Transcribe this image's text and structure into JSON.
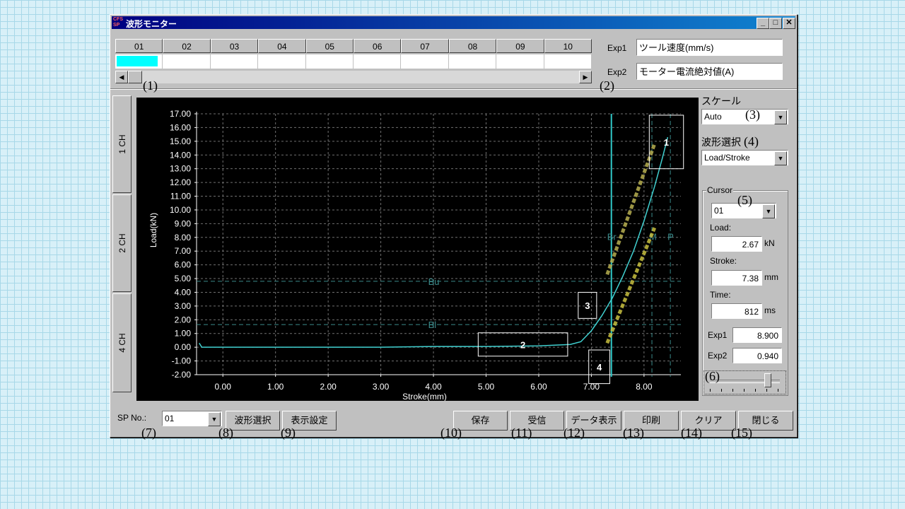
{
  "window": {
    "title": "波形モニター",
    "app_icon_text": "CFS SP"
  },
  "channels": [
    "01",
    "02",
    "03",
    "04",
    "05",
    "06",
    "07",
    "08",
    "09",
    "10"
  ],
  "channel_colors": [
    "#00ffff",
    "#ffffff",
    "#ffffff",
    "#ffffff",
    "#ffffff",
    "#ffffff",
    "#ffffff",
    "#ffffff",
    "#ffffff",
    "#ffffff"
  ],
  "exp": {
    "exp1_label": "Exp1",
    "exp1_value": "ツール速度(mm/s)",
    "exp2_label": "Exp2",
    "exp2_value": "モーター電流絶対値(A)"
  },
  "side_tabs": [
    "1 CH",
    "2 CH",
    "4 CH"
  ],
  "scale": {
    "label": "スケール",
    "value": "Auto"
  },
  "waveform": {
    "label": "波形選択",
    "value": "Load/Stroke"
  },
  "cursor": {
    "group_label": "Cursor",
    "select_value": "01",
    "load_label": "Load:",
    "load_value": "2.67",
    "load_unit": "kN",
    "stroke_label": "Stroke:",
    "stroke_value": "7.38",
    "stroke_unit": "mm",
    "time_label": "Time:",
    "time_value": "812",
    "time_unit": "ms",
    "exp1_label": "Exp1",
    "exp1_value": "8.900",
    "exp2_label": "Exp2",
    "exp2_value": "0.940",
    "slider_level": 0.9
  },
  "bottom": {
    "sp_label": "SP No.:",
    "sp_value": "01",
    "buttons": [
      "波形選択",
      "表示設定",
      "保存",
      "受信",
      "データ表示",
      "印刷",
      "クリア",
      "閉じる"
    ]
  },
  "callouts": [
    "(1)",
    "(2)",
    "(3)",
    "(4)",
    "(5)",
    "(6)",
    "(7)",
    "(8)",
    "(9)",
    "(10)",
    "(11)",
    "(12)",
    "(13)",
    "(14)",
    "(15)"
  ],
  "chart_data": {
    "type": "line",
    "xlabel": "Stroke(mm)",
    "ylabel": "Load(kN)",
    "xlim": [
      -0.5,
      8.7
    ],
    "ylim": [
      -2.0,
      17.0
    ],
    "xticks": [
      "0.00",
      "1.00",
      "2.00",
      "3.00",
      "4.00",
      "5.00",
      "6.00",
      "7.00",
      "8.00"
    ],
    "yticks": [
      "17.00",
      "16.00",
      "15.00",
      "14.00",
      "13.00",
      "12.00",
      "11.00",
      "10.00",
      "9.00",
      "8.00",
      "7.00",
      "6.00",
      "5.00",
      "4.00",
      "3.00",
      "2.00",
      "1.00",
      "0.00",
      "-1.00",
      "-2.00"
    ],
    "grid": true,
    "series": [
      {
        "color": "#40d0d0",
        "x": [
          -0.45,
          -0.4,
          0,
          1,
          2,
          3,
          4,
          5,
          6,
          6.6,
          6.8,
          7.0,
          7.2,
          7.4,
          7.6,
          7.8,
          8.0,
          8.2,
          8.35,
          8.45
        ],
        "y": [
          0.3,
          0.0,
          0.0,
          0.0,
          0.0,
          0.0,
          0.05,
          0.05,
          0.1,
          0.2,
          0.4,
          1.2,
          2.3,
          3.6,
          5.2,
          7.0,
          9.2,
          11.7,
          13.8,
          15.3
        ]
      }
    ],
    "fit_lines": [
      {
        "color": "#b8b050",
        "x": [
          7.3,
          8.2
        ],
        "y": [
          5.3,
          14.8
        ]
      },
      {
        "color": "#c8c040",
        "x": [
          7.3,
          8.2
        ],
        "y": [
          0.3,
          8.7
        ]
      }
    ],
    "cursor_x": 7.38,
    "markers_v": [
      {
        "label": "Br",
        "x": 7.38
      },
      {
        "label": "M",
        "x": 8.15
      },
      {
        "label": "P",
        "x": 8.5
      }
    ],
    "markers_h": [
      {
        "label": "Bu",
        "y": 4.8
      },
      {
        "label": "Bl",
        "y": 1.65
      }
    ],
    "boxes": [
      {
        "label": "1",
        "x": [
          8.1,
          8.75
        ],
        "y": [
          13.0,
          16.9
        ]
      },
      {
        "label": "2",
        "x": [
          4.85,
          6.55
        ],
        "y": [
          -0.65,
          1.05
        ]
      },
      {
        "label": "3",
        "x": [
          6.75,
          7.1
        ],
        "y": [
          2.1,
          4.0
        ]
      },
      {
        "label": "4",
        "x": [
          6.95,
          7.35
        ],
        "y": [
          -2.65,
          -0.2
        ]
      }
    ]
  }
}
